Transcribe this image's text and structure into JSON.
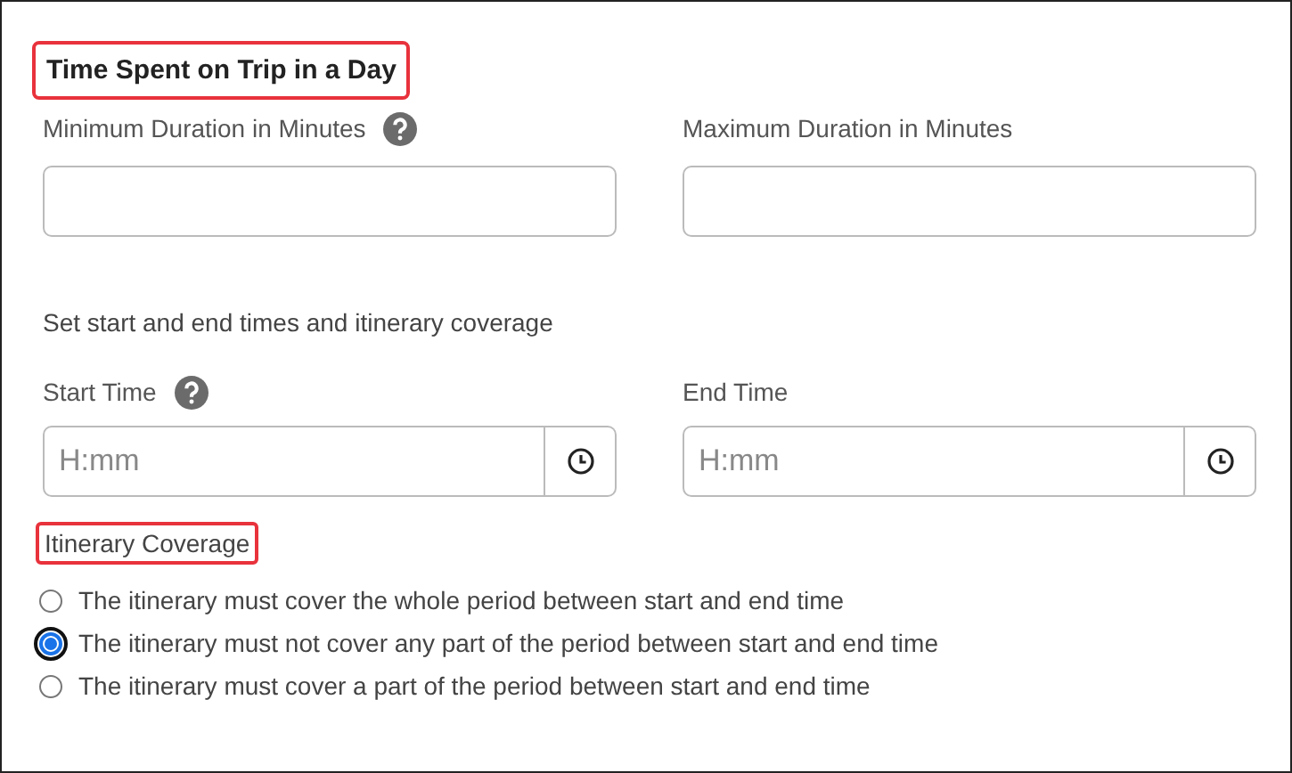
{
  "section_title": {
    "text": "Time Spent on Trip in a Day",
    "highlighted": true
  },
  "duration_fields": [
    {
      "label": "Minimum Duration in Minutes",
      "help": true
    },
    {
      "label": "Maximum Duration in Minutes",
      "help": false
    }
  ],
  "instructions": "Set start and end times and itinerary coverage",
  "time_fields": [
    {
      "label": "Start Time",
      "help": true,
      "placeholder": "H:mm"
    },
    {
      "label": "End Time",
      "help": false,
      "placeholder": "H:mm"
    }
  ],
  "coverage": {
    "title": "Itinerary Coverage",
    "highlighted": true,
    "options": [
      {
        "label": "The itinerary must cover the whole period between start and end time",
        "selected": false
      },
      {
        "label": "The itinerary must not cover any part of the period between start and end time",
        "selected": true
      },
      {
        "label": "The itinerary must cover a part of the period between start and end time",
        "selected": false
      }
    ]
  }
}
